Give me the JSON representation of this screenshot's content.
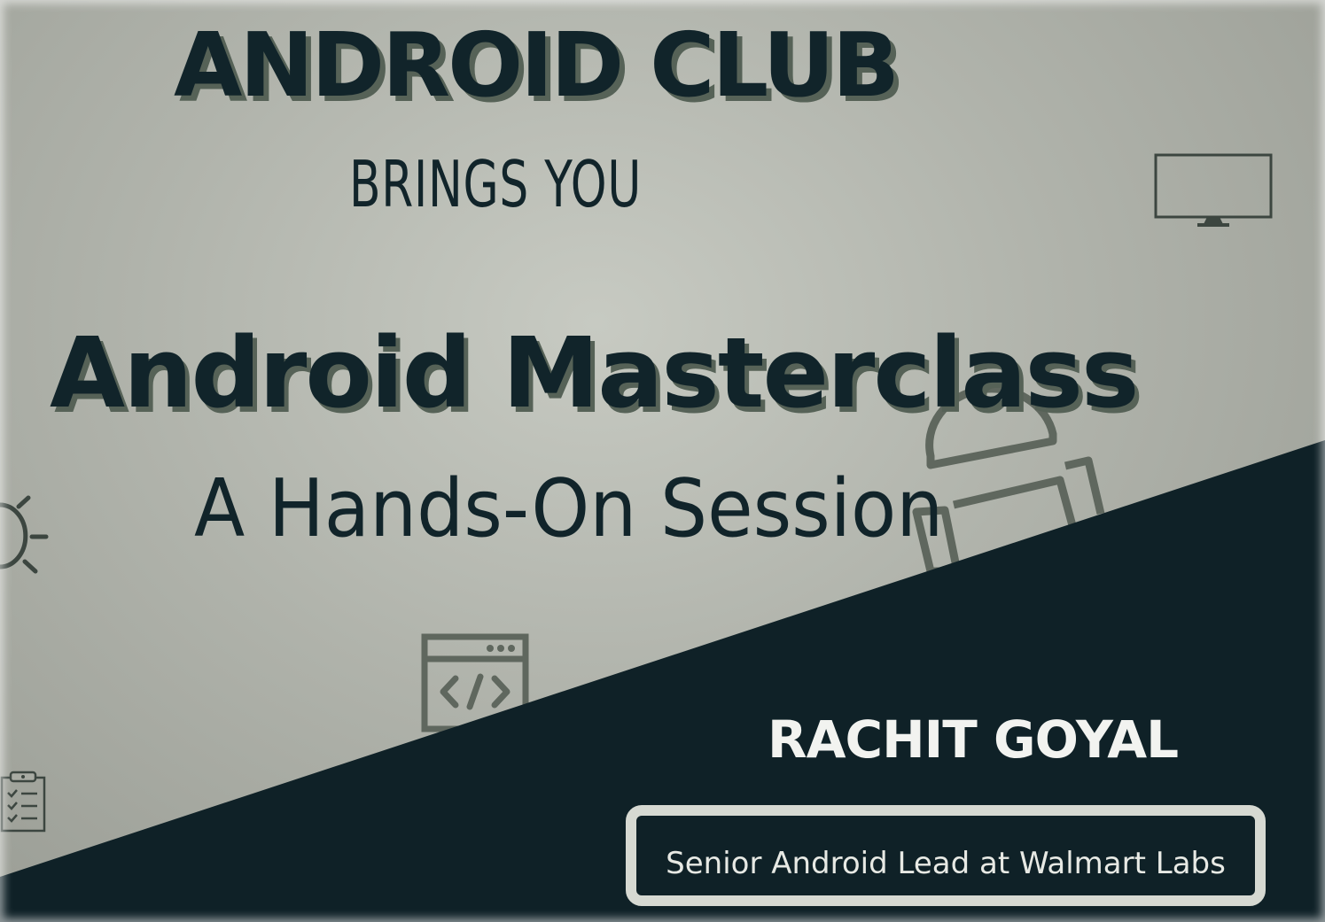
{
  "poster": {
    "club_title": "ANDROID CLUB",
    "brings_you": "BRINGS YOU",
    "event_title": "Android Masterclass",
    "event_subtitle": "A Hands-On Session",
    "speaker_name": "RACHIT GOYAL",
    "speaker_role": "Senior Android Lead at Walmart Labs"
  },
  "colors": {
    "background": "#a3a69d",
    "dark_panel": "#0f2127",
    "title_text": "#11242a",
    "text_shadow": "#566257",
    "icon_stroke": "#5f675e",
    "speaker_text": "#f2f3f0",
    "role_border": "#d6d9d2"
  },
  "icons": [
    "monitor-icon",
    "android-robot-icon",
    "code-window-icon",
    "sun-icon",
    "clipboard-checklist-icon"
  ]
}
